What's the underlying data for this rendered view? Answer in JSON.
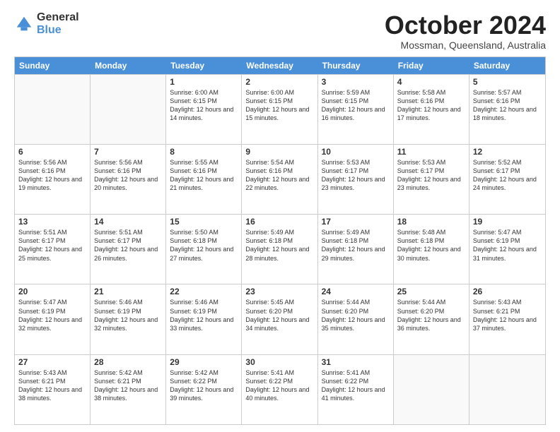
{
  "logo": {
    "general": "General",
    "blue": "Blue"
  },
  "header": {
    "month": "October 2024",
    "location": "Mossman, Queensland, Australia"
  },
  "weekdays": [
    "Sunday",
    "Monday",
    "Tuesday",
    "Wednesday",
    "Thursday",
    "Friday",
    "Saturday"
  ],
  "weeks": [
    [
      {
        "day": "",
        "sunrise": "",
        "sunset": "",
        "daylight": ""
      },
      {
        "day": "",
        "sunrise": "",
        "sunset": "",
        "daylight": ""
      },
      {
        "day": "1",
        "sunrise": "Sunrise: 6:00 AM",
        "sunset": "Sunset: 6:15 PM",
        "daylight": "Daylight: 12 hours and 14 minutes."
      },
      {
        "day": "2",
        "sunrise": "Sunrise: 6:00 AM",
        "sunset": "Sunset: 6:15 PM",
        "daylight": "Daylight: 12 hours and 15 minutes."
      },
      {
        "day": "3",
        "sunrise": "Sunrise: 5:59 AM",
        "sunset": "Sunset: 6:15 PM",
        "daylight": "Daylight: 12 hours and 16 minutes."
      },
      {
        "day": "4",
        "sunrise": "Sunrise: 5:58 AM",
        "sunset": "Sunset: 6:16 PM",
        "daylight": "Daylight: 12 hours and 17 minutes."
      },
      {
        "day": "5",
        "sunrise": "Sunrise: 5:57 AM",
        "sunset": "Sunset: 6:16 PM",
        "daylight": "Daylight: 12 hours and 18 minutes."
      }
    ],
    [
      {
        "day": "6",
        "sunrise": "Sunrise: 5:56 AM",
        "sunset": "Sunset: 6:16 PM",
        "daylight": "Daylight: 12 hours and 19 minutes."
      },
      {
        "day": "7",
        "sunrise": "Sunrise: 5:56 AM",
        "sunset": "Sunset: 6:16 PM",
        "daylight": "Daylight: 12 hours and 20 minutes."
      },
      {
        "day": "8",
        "sunrise": "Sunrise: 5:55 AM",
        "sunset": "Sunset: 6:16 PM",
        "daylight": "Daylight: 12 hours and 21 minutes."
      },
      {
        "day": "9",
        "sunrise": "Sunrise: 5:54 AM",
        "sunset": "Sunset: 6:16 PM",
        "daylight": "Daylight: 12 hours and 22 minutes."
      },
      {
        "day": "10",
        "sunrise": "Sunrise: 5:53 AM",
        "sunset": "Sunset: 6:17 PM",
        "daylight": "Daylight: 12 hours and 23 minutes."
      },
      {
        "day": "11",
        "sunrise": "Sunrise: 5:53 AM",
        "sunset": "Sunset: 6:17 PM",
        "daylight": "Daylight: 12 hours and 23 minutes."
      },
      {
        "day": "12",
        "sunrise": "Sunrise: 5:52 AM",
        "sunset": "Sunset: 6:17 PM",
        "daylight": "Daylight: 12 hours and 24 minutes."
      }
    ],
    [
      {
        "day": "13",
        "sunrise": "Sunrise: 5:51 AM",
        "sunset": "Sunset: 6:17 PM",
        "daylight": "Daylight: 12 hours and 25 minutes."
      },
      {
        "day": "14",
        "sunrise": "Sunrise: 5:51 AM",
        "sunset": "Sunset: 6:17 PM",
        "daylight": "Daylight: 12 hours and 26 minutes."
      },
      {
        "day": "15",
        "sunrise": "Sunrise: 5:50 AM",
        "sunset": "Sunset: 6:18 PM",
        "daylight": "Daylight: 12 hours and 27 minutes."
      },
      {
        "day": "16",
        "sunrise": "Sunrise: 5:49 AM",
        "sunset": "Sunset: 6:18 PM",
        "daylight": "Daylight: 12 hours and 28 minutes."
      },
      {
        "day": "17",
        "sunrise": "Sunrise: 5:49 AM",
        "sunset": "Sunset: 6:18 PM",
        "daylight": "Daylight: 12 hours and 29 minutes."
      },
      {
        "day": "18",
        "sunrise": "Sunrise: 5:48 AM",
        "sunset": "Sunset: 6:18 PM",
        "daylight": "Daylight: 12 hours and 30 minutes."
      },
      {
        "day": "19",
        "sunrise": "Sunrise: 5:47 AM",
        "sunset": "Sunset: 6:19 PM",
        "daylight": "Daylight: 12 hours and 31 minutes."
      }
    ],
    [
      {
        "day": "20",
        "sunrise": "Sunrise: 5:47 AM",
        "sunset": "Sunset: 6:19 PM",
        "daylight": "Daylight: 12 hours and 32 minutes."
      },
      {
        "day": "21",
        "sunrise": "Sunrise: 5:46 AM",
        "sunset": "Sunset: 6:19 PM",
        "daylight": "Daylight: 12 hours and 32 minutes."
      },
      {
        "day": "22",
        "sunrise": "Sunrise: 5:46 AM",
        "sunset": "Sunset: 6:19 PM",
        "daylight": "Daylight: 12 hours and 33 minutes."
      },
      {
        "day": "23",
        "sunrise": "Sunrise: 5:45 AM",
        "sunset": "Sunset: 6:20 PM",
        "daylight": "Daylight: 12 hours and 34 minutes."
      },
      {
        "day": "24",
        "sunrise": "Sunrise: 5:44 AM",
        "sunset": "Sunset: 6:20 PM",
        "daylight": "Daylight: 12 hours and 35 minutes."
      },
      {
        "day": "25",
        "sunrise": "Sunrise: 5:44 AM",
        "sunset": "Sunset: 6:20 PM",
        "daylight": "Daylight: 12 hours and 36 minutes."
      },
      {
        "day": "26",
        "sunrise": "Sunrise: 5:43 AM",
        "sunset": "Sunset: 6:21 PM",
        "daylight": "Daylight: 12 hours and 37 minutes."
      }
    ],
    [
      {
        "day": "27",
        "sunrise": "Sunrise: 5:43 AM",
        "sunset": "Sunset: 6:21 PM",
        "daylight": "Daylight: 12 hours and 38 minutes."
      },
      {
        "day": "28",
        "sunrise": "Sunrise: 5:42 AM",
        "sunset": "Sunset: 6:21 PM",
        "daylight": "Daylight: 12 hours and 38 minutes."
      },
      {
        "day": "29",
        "sunrise": "Sunrise: 5:42 AM",
        "sunset": "Sunset: 6:22 PM",
        "daylight": "Daylight: 12 hours and 39 minutes."
      },
      {
        "day": "30",
        "sunrise": "Sunrise: 5:41 AM",
        "sunset": "Sunset: 6:22 PM",
        "daylight": "Daylight: 12 hours and 40 minutes."
      },
      {
        "day": "31",
        "sunrise": "Sunrise: 5:41 AM",
        "sunset": "Sunset: 6:22 PM",
        "daylight": "Daylight: 12 hours and 41 minutes."
      },
      {
        "day": "",
        "sunrise": "",
        "sunset": "",
        "daylight": ""
      },
      {
        "day": "",
        "sunrise": "",
        "sunset": "",
        "daylight": ""
      }
    ]
  ]
}
